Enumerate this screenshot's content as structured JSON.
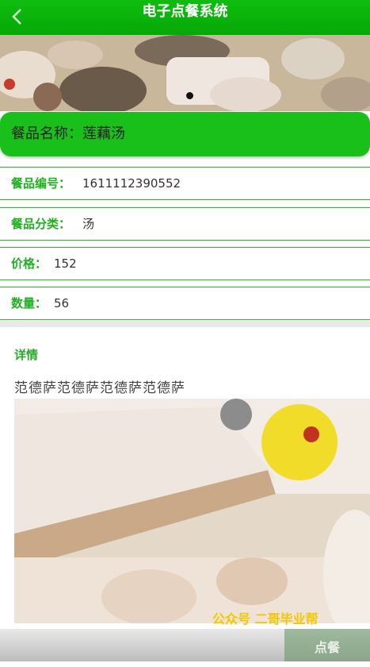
{
  "header": {
    "title": "电子点餐系统"
  },
  "dish": {
    "name_label": "餐品名称：",
    "name": "莲藕汤",
    "fields": [
      {
        "label": "餐品编号：",
        "value": "1611112390552"
      },
      {
        "label": "餐品分类：",
        "value": "汤"
      },
      {
        "label": "价格：",
        "value": "152"
      },
      {
        "label": "数量：",
        "value": "56"
      }
    ]
  },
  "details": {
    "label": "详情",
    "text": "范德萨范德萨范德萨范德萨"
  },
  "watermark": "公众号 二哥毕业帮",
  "footer": {
    "order_label": "点餐"
  },
  "colors": {
    "accent": "#19c019",
    "label_green": "#20b020",
    "order_button": "#8aa58a"
  }
}
